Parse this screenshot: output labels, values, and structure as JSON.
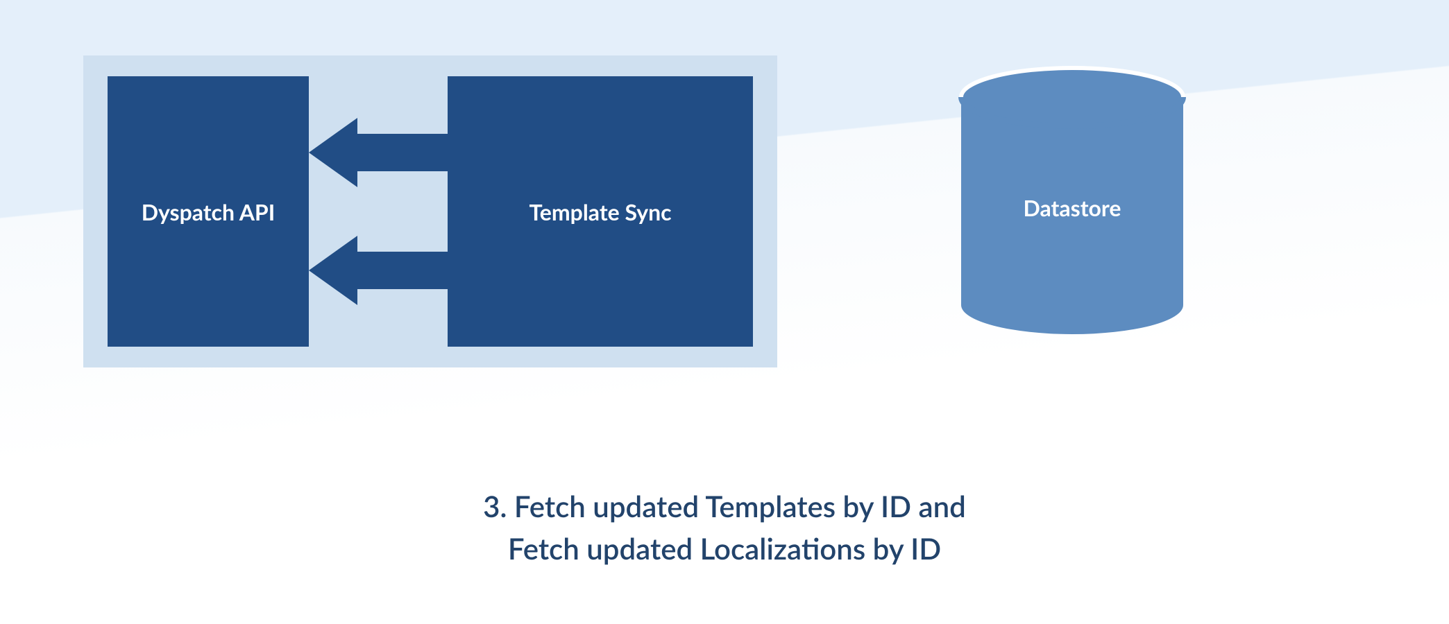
{
  "boxes": {
    "api_label": "Dyspatch API",
    "sync_label": "Template Sync",
    "datastore_label": "Datastore"
  },
  "caption": {
    "line1": "3. Fetch updated Templates by ID and",
    "line2": "Fetch updated Localizations by ID"
  },
  "colors": {
    "container_bg": "#cfe0f0",
    "box_fill": "#214d85",
    "datastore_fill": "#5d8cc0",
    "text_light": "#ffffff",
    "caption_color": "#22436b"
  }
}
